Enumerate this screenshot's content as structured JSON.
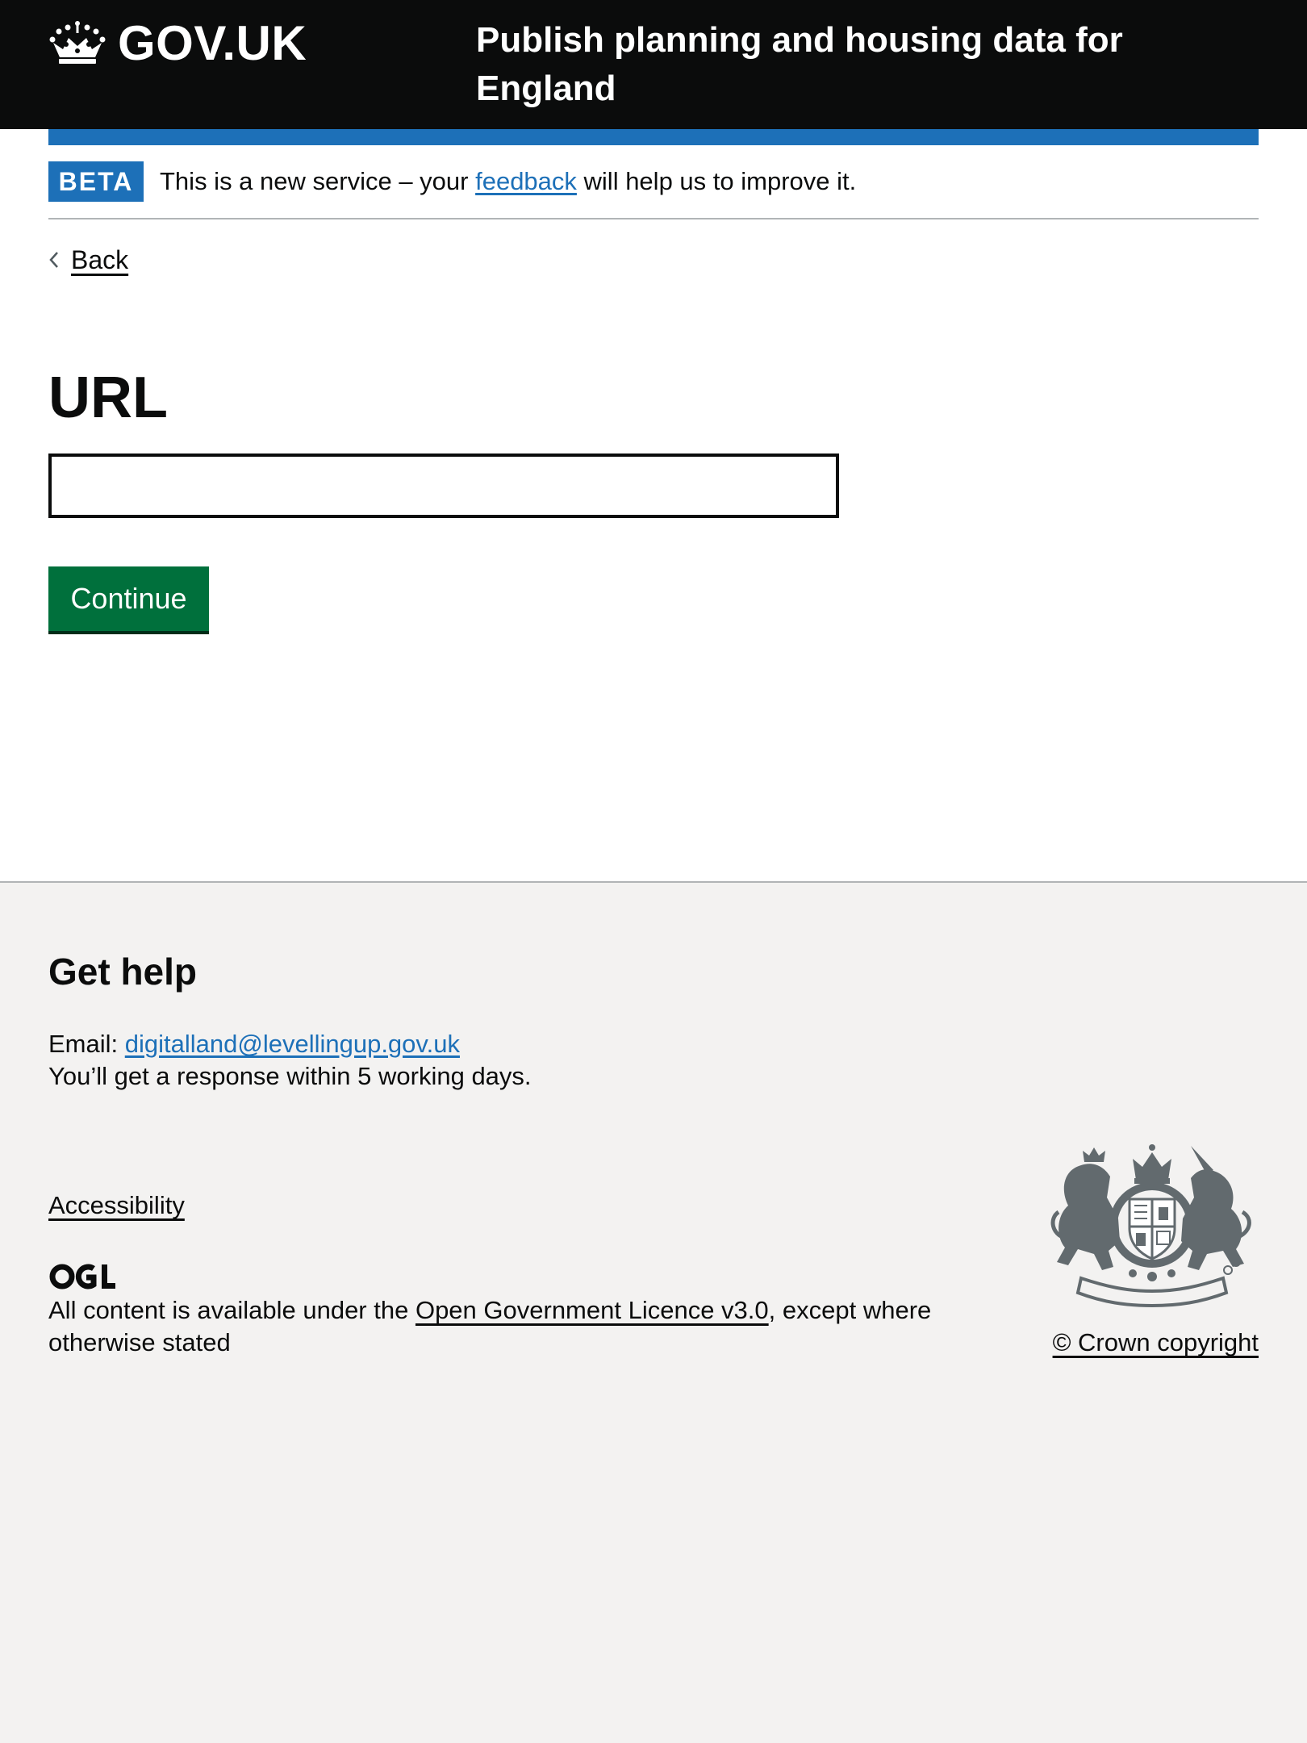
{
  "header": {
    "logo_text": "GOV.UK",
    "service_name": "Publish planning and housing data for England"
  },
  "phase_banner": {
    "tag": "BETA",
    "text_before": "This is a new service – your ",
    "link_text": "feedback",
    "text_after": " will help us to improve it."
  },
  "back_link": {
    "label": "Back"
  },
  "main": {
    "heading": "URL",
    "input_value": "",
    "continue_label": "Continue"
  },
  "footer": {
    "help_heading": "Get help",
    "email_label": "Email: ",
    "email_address": "digitalland@levellingup.gov.uk",
    "response_text": "You’ll get a response within 5 working days.",
    "accessibility_label": "Accessibility",
    "licence_before": "All content is available under the ",
    "licence_link": "Open Government Licence v3.0",
    "licence_after": ", except where otherwise stated",
    "copyright_label": "© Crown copyright"
  },
  "icons": [
    "crown-icon",
    "chevron-left-icon",
    "ogl-icon",
    "royal-arms-icon"
  ],
  "colors": {
    "header_bg": "#0b0c0c",
    "brand_blue": "#1d70b8",
    "button_green": "#00703c",
    "footer_bg": "#f3f2f1",
    "border_grey": "#b1b4b6",
    "arms_grey": "#626a6e"
  }
}
